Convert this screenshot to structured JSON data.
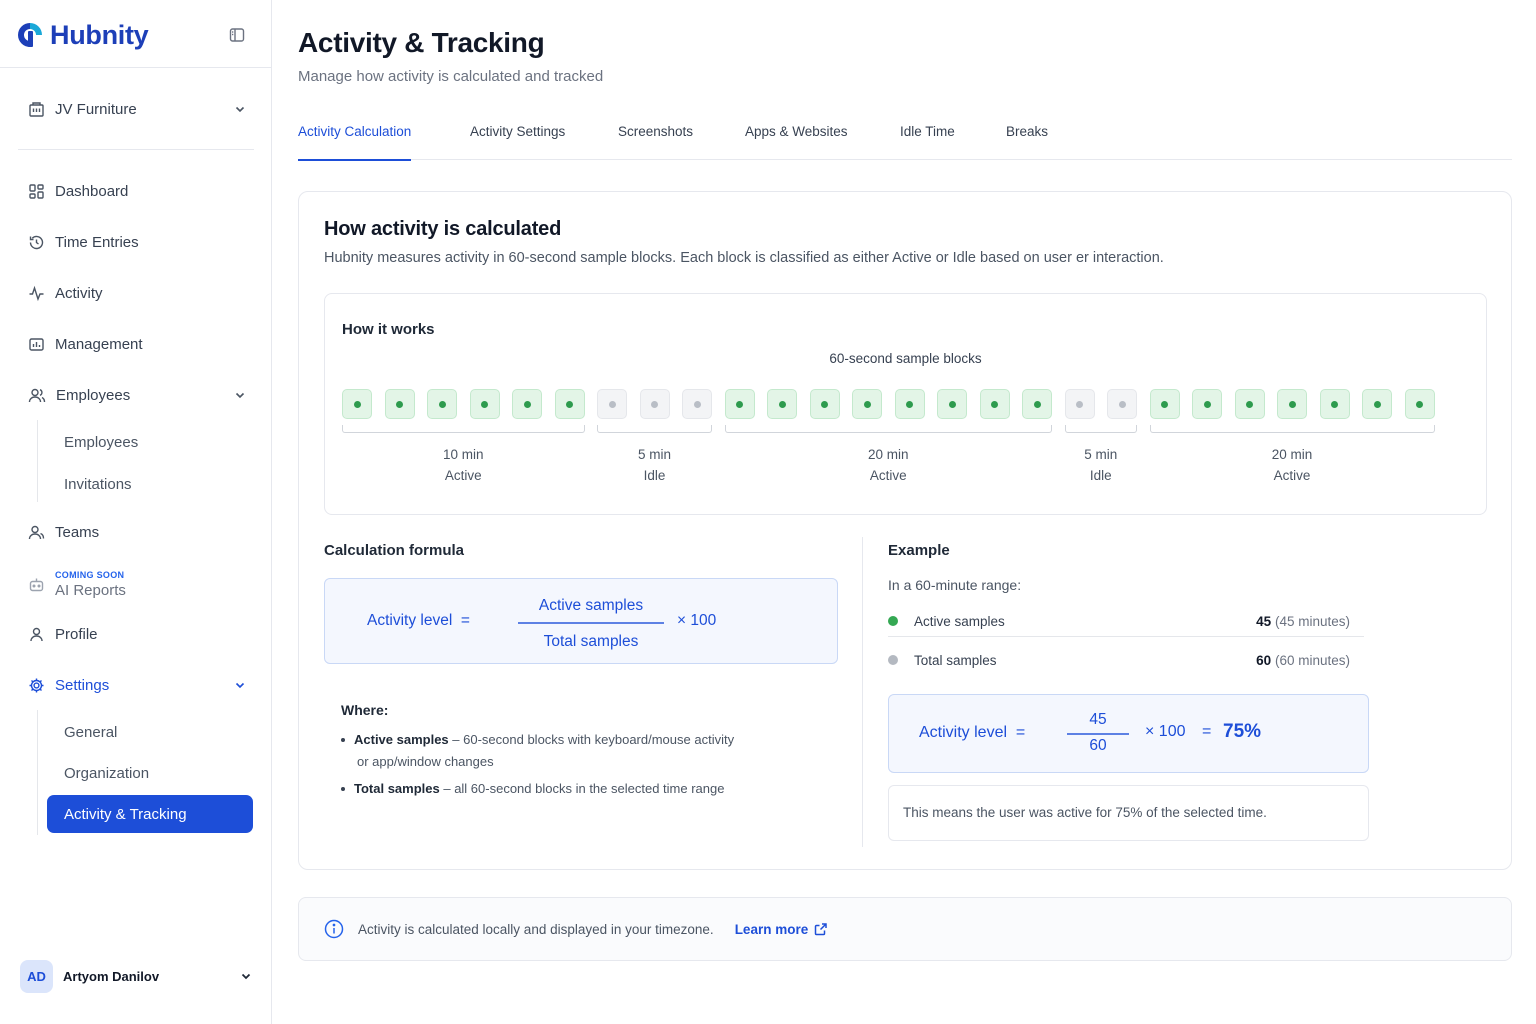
{
  "brand": {
    "name": "Hubnity",
    "logo_icon": "hubnity-logo-icon",
    "accent": "#1d4ed8"
  },
  "sidebar": {
    "workspace": {
      "label": "JV Furniture",
      "icon": "building-icon"
    },
    "items": [
      {
        "label": "Dashboard",
        "icon": "dashboard-icon"
      },
      {
        "label": "Time Entries",
        "icon": "history-icon"
      },
      {
        "label": "Activity",
        "icon": "pulse-icon"
      },
      {
        "label": "Management",
        "icon": "chart-icon"
      },
      {
        "label": "Employees",
        "icon": "users-icon"
      },
      {
        "label": "Teams",
        "icon": "team-icon"
      },
      {
        "label": "AI Reports",
        "icon": "robot-icon",
        "badge": "COMING SOON"
      },
      {
        "label": "Profile",
        "icon": "user-icon"
      },
      {
        "label": "Settings",
        "icon": "gear-icon"
      }
    ],
    "employees_sub": [
      "Employees",
      "Invitations"
    ],
    "settings_sub": [
      "General",
      "Organization",
      "Activity & Tracking"
    ],
    "user": {
      "initials": "AD",
      "name": "Artyom Danilov"
    }
  },
  "header": {
    "title": "Activity & Tracking",
    "subtitle": "Manage how activity is calculated and tracked"
  },
  "tabs": [
    "Activity Calculation",
    "Activity Settings",
    "Screenshots",
    "Apps & Websites",
    "Idle Time",
    "Breaks"
  ],
  "active_tab": "Activity Calculation",
  "calc": {
    "title": "How activity is calculated",
    "description": "Hubnity measures activity in 60-second sample blocks. Each block is classified as either Active or Idle based on user er interaction.",
    "how": {
      "title": "How it works",
      "caption": "60-second sample blocks",
      "segments": [
        {
          "minutes": "10 min",
          "state": "Active",
          "type": "active"
        },
        {
          "minutes": "5 min",
          "state": "Idle",
          "type": "idle"
        },
        {
          "minutes": "20 min",
          "state": "Active",
          "type": "active"
        },
        {
          "minutes": "5 min",
          "state": "Idle",
          "type": "idle"
        },
        {
          "minutes": "20 min",
          "state": "Active",
          "type": "active"
        }
      ],
      "block_sequence": [
        "active",
        "active",
        "active",
        "active",
        "active",
        "active",
        "idle",
        "idle",
        "idle",
        "active",
        "active",
        "active",
        "active",
        "active",
        "active",
        "active",
        "active",
        "idle",
        "idle",
        "active",
        "active",
        "active",
        "active",
        "active",
        "active",
        "active"
      ],
      "colors": {
        "active_fill": "#e3f5e7",
        "active_dot": "#2e9b4e",
        "idle_fill": "#f3f4f6",
        "idle_dot": "#b9bec6"
      }
    },
    "formula": {
      "title": "Calculation formula",
      "lhs": "Activity level  =",
      "numerator": "Active samples",
      "denominator": "Total samples",
      "multiplier": "× 100"
    },
    "where": {
      "title": "Where:",
      "items": [
        {
          "term": "Active samples",
          "desc": " – 60-second blocks with keyboard/mouse activity",
          "desc2": "or app/window changes"
        },
        {
          "term": "Total samples",
          "desc": " – all 60-second blocks in the selected time range"
        }
      ]
    },
    "example": {
      "title": "Example",
      "range": "In a 60-minute range:",
      "rows": [
        {
          "label": "Active samples",
          "value": "45",
          "unit": "(45 minutes)",
          "color": "#34a853"
        },
        {
          "label": "Total samples",
          "value": "60",
          "unit": "(60 minutes)",
          "color": "#b4b9c1"
        }
      ],
      "lhs": "Activity level  =",
      "numerator": "45",
      "denominator": "60",
      "multiplier": "× 100",
      "equals": "=",
      "result": "75%",
      "note": "This means the user was active for 75% of the selected time."
    }
  },
  "info": {
    "text": "Activity is calculated locally and displayed in your timezone.",
    "link": "Learn more"
  }
}
